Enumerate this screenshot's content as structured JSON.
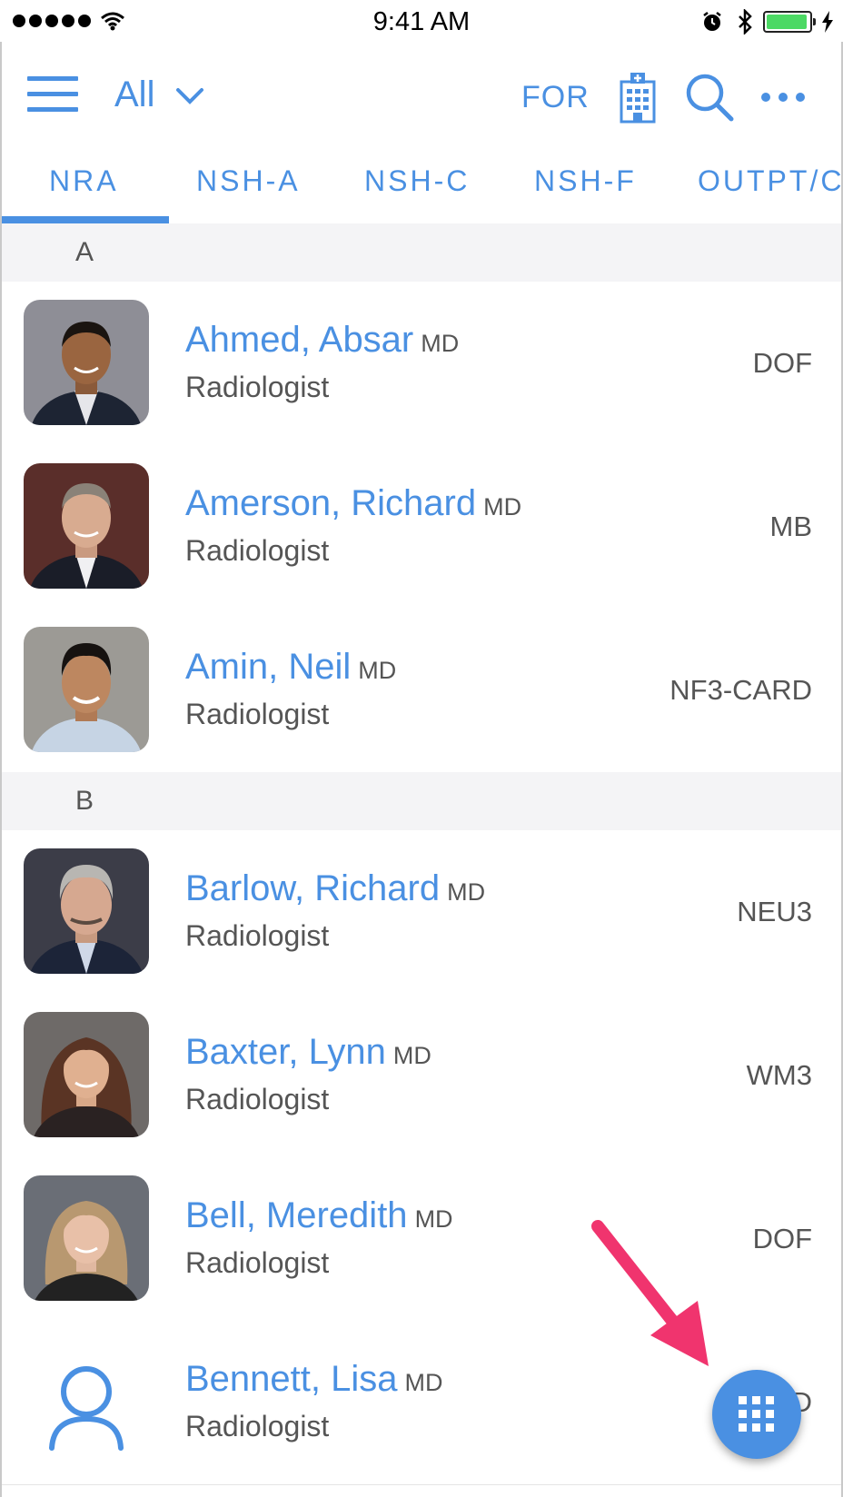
{
  "status_bar": {
    "time": "9:41 AM",
    "battery_level": 0.95
  },
  "nav": {
    "filter_label": "All",
    "for_label": "FOR"
  },
  "tabs": [
    {
      "label": "NRA",
      "selected": true
    },
    {
      "label": "NSH-A",
      "selected": false
    },
    {
      "label": "NSH-C",
      "selected": false
    },
    {
      "label": "NSH-F",
      "selected": false
    },
    {
      "label": "OUTPT/C",
      "selected": false
    }
  ],
  "sections": [
    {
      "letter": "A"
    },
    {
      "letter": "B"
    }
  ],
  "people": [
    {
      "name": "Ahmed, Absar",
      "credential": "MD",
      "role": "Radiologist",
      "location": "DOF"
    },
    {
      "name": "Amerson, Richard",
      "credential": "MD",
      "role": "Radiologist",
      "location": "MB"
    },
    {
      "name": "Amin, Neil",
      "credential": "MD",
      "role": "Radiologist",
      "location": "NF3-CARD"
    },
    {
      "name": "Barlow, Richard",
      "credential": "MD",
      "role": "Radiologist",
      "location": "NEU3"
    },
    {
      "name": "Baxter, Lynn",
      "credential": "MD",
      "role": "Radiologist",
      "location": "WM3"
    },
    {
      "name": "Bell, Meredith",
      "credential": "MD",
      "role": "Radiologist",
      "location": "DOF"
    },
    {
      "name": "Bennett, Lisa",
      "credential": "MD",
      "role": "Radiologist",
      "location": "D"
    }
  ],
  "colors": {
    "accent": "#4a90e2",
    "annotation_arrow": "#f0346e"
  },
  "icons": {
    "menu": "hamburger-menu-icon",
    "dropdown": "chevron-down-icon",
    "hospital": "hospital-building-icon",
    "search": "search-icon",
    "more": "more-dots-icon",
    "fab": "keypad-grid-icon",
    "placeholder_avatar": "person-outline-icon"
  }
}
